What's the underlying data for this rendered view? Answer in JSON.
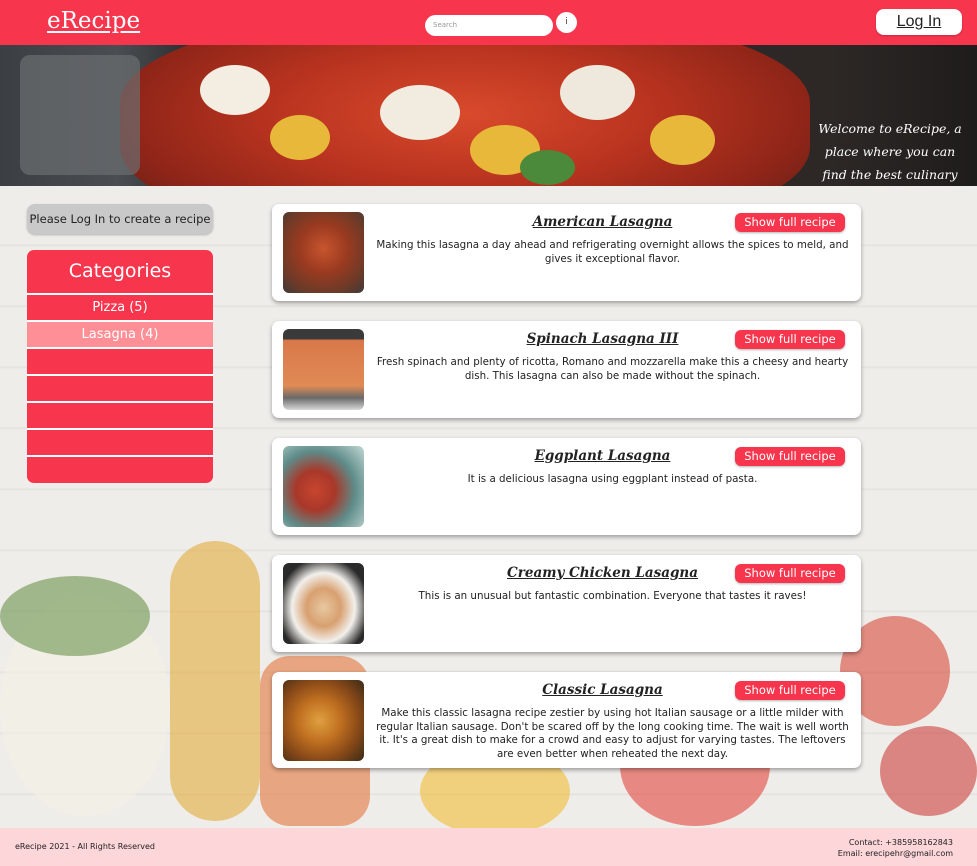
{
  "header": {
    "logo": "eRecipe",
    "search_placeholder": "Search",
    "search_button": "i",
    "login_label": "Log In"
  },
  "hero": {
    "welcome_text": "Welcome to eRecipe, a place where you can find the best culinary examples in the world!"
  },
  "sidebar": {
    "login_notice": "Please Log In to create a recipe",
    "categories_title": "Categories",
    "categories": [
      {
        "label": "Pizza (5)",
        "active": false
      },
      {
        "label": "Lasagna (4)",
        "active": true
      },
      {
        "label": "",
        "active": false
      },
      {
        "label": "",
        "active": false
      },
      {
        "label": "",
        "active": false
      },
      {
        "label": "",
        "active": false
      },
      {
        "label": "",
        "active": false
      }
    ]
  },
  "recipes": [
    {
      "title": "American Lasagna",
      "button": "Show full recipe",
      "description": "Making this lasagna a day ahead and refrigerating overnight allows the spices to meld, and gives it exceptional flavor."
    },
    {
      "title": "Spinach Lasagna III",
      "button": "Show full recipe",
      "description": "Fresh spinach and plenty of ricotta, Romano and mozzarella make this a cheesy and hearty dish. This lasagna can also be made without the spinach."
    },
    {
      "title": "Eggplant Lasagna",
      "button": "Show full recipe",
      "description": "It is a delicious lasagna using eggplant instead of pasta."
    },
    {
      "title": "Creamy Chicken Lasagna",
      "button": "Show full recipe",
      "description": "This is an unusual but fantastic combination. Everyone that tastes it raves!"
    },
    {
      "title": "Classic Lasagna",
      "button": "Show full recipe",
      "description": "Make this classic lasagna recipe zestier by using hot Italian sausage or a little milder with regular Italian sausage. Don't be scared off by the long cooking time. The wait is well worth it. It's a great dish to make for a crowd and easy to adjust for varying tastes. The leftovers are even better when reheated the next day."
    }
  ],
  "footer": {
    "copyright": "eRecipe 2021 - All Rights Reserved",
    "contact_phone": "Contact: +385958162843",
    "contact_email": "Email: erecipehr@gmail.com"
  },
  "colors": {
    "accent": "#f7354d",
    "active_category": "#ff8f96",
    "footer_bg": "#fdd6d9"
  }
}
